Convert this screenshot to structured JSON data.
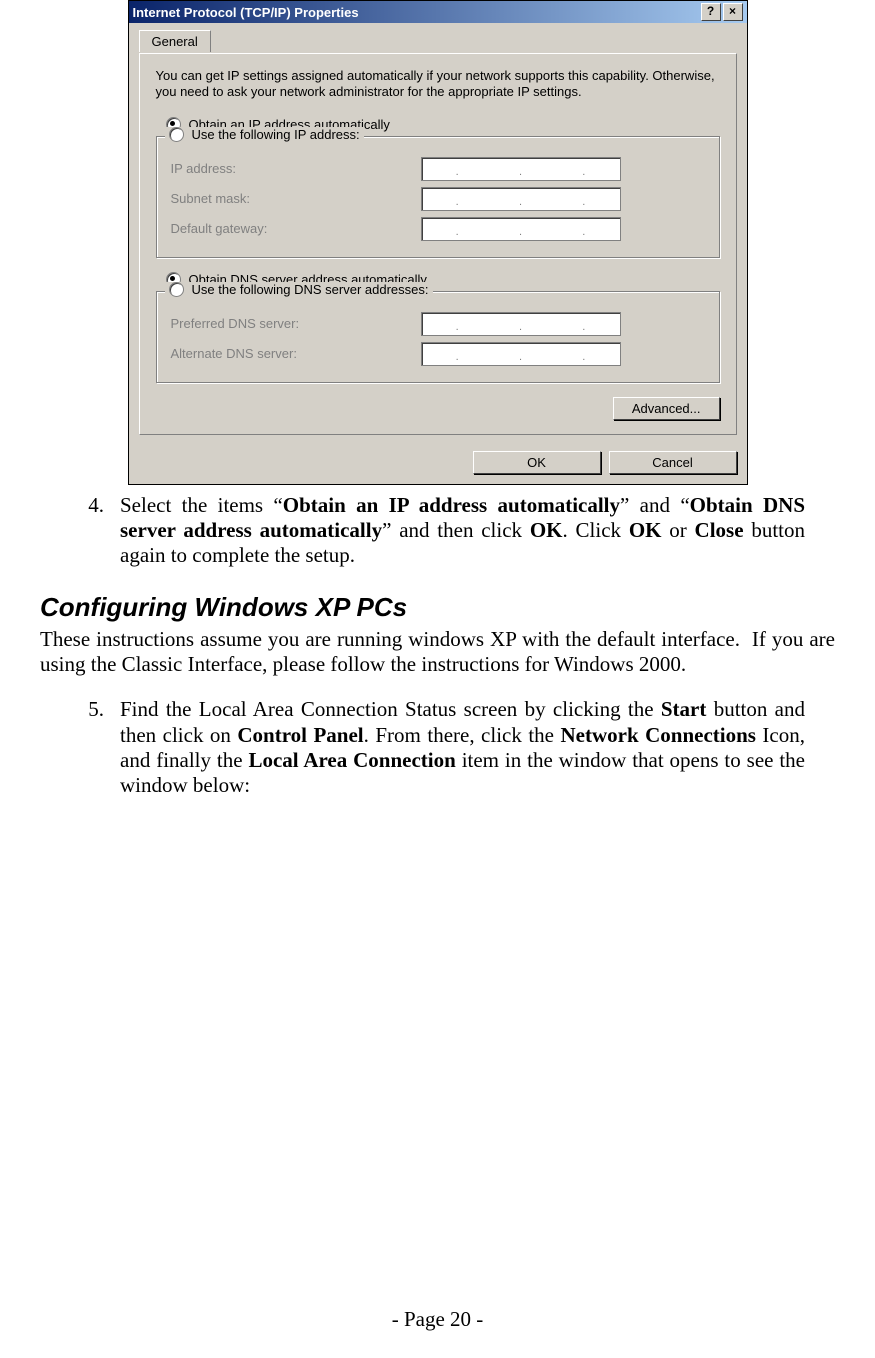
{
  "dialog": {
    "title": "Internet Protocol (TCP/IP) Properties",
    "help_glyph": "?",
    "close_glyph": "×",
    "tab_label": "General",
    "intro": "You can get IP settings assigned automatically if your network supports this capability. Otherwise, you need to ask your network administrator for the appropriate IP settings.",
    "radio_ip_auto": "Obtain an IP address automatically",
    "radio_ip_manual": "Use the following IP address:",
    "ip_fields": {
      "ip_address": "IP address:",
      "subnet": "Subnet mask:",
      "gateway": "Default gateway:"
    },
    "radio_dns_auto": "Obtain DNS server address automatically",
    "radio_dns_manual": "Use the following DNS server addresses:",
    "dns_fields": {
      "preferred": "Preferred DNS server:",
      "alternate": "Alternate DNS server:"
    },
    "advanced_btn": "Advanced...",
    "ok_btn": "OK",
    "cancel_btn": "Cancel"
  },
  "doc": {
    "step4_num": "4.",
    "step4_a": "Select the items “",
    "step4_b1": "Obtain an IP address automatically",
    "step4_c": "” and “",
    "step4_b2": "Obtain DNS server address automatically",
    "step4_d": "” and then click ",
    "step4_b3": "OK",
    "step4_e": ". Click ",
    "step4_b4": "OK",
    "step4_f": " or ",
    "step4_b5": "Close",
    "step4_g": " button again to complete the setup.",
    "heading": "Configuring Windows XP PCs",
    "intro": "These instructions assume you are running windows XP with the default interface.  If you are using the Classic Interface, please follow the instructions for Windows 2000.",
    "step5_num": "5.",
    "step5_a": "Find the Local Area Connection Status screen by clicking the ",
    "step5_b1": "Start",
    "step5_c": " button and then click on ",
    "step5_b2": "Control Panel",
    "step5_d": ". From there, click the ",
    "step5_b3": "Network Connections",
    "step5_e": " Icon, and finally the ",
    "step5_b4": "Local Area Connection",
    "step5_f": " item in the window that opens to see the window below:",
    "footer": "- Page 20 -"
  }
}
